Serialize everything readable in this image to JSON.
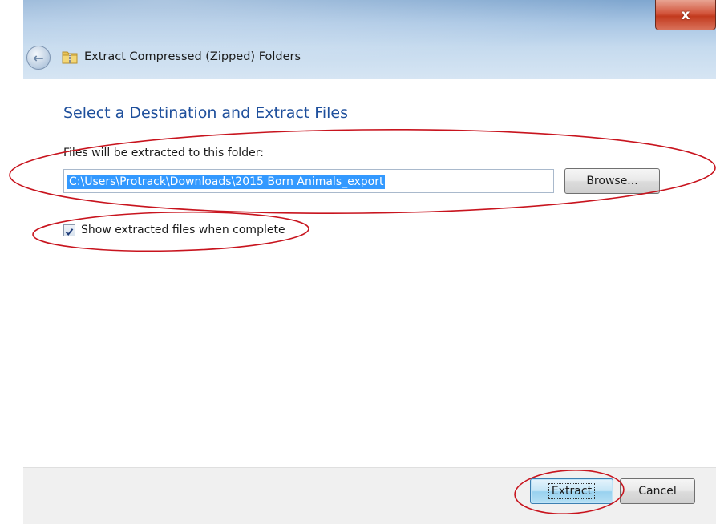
{
  "window": {
    "title": "Extract Compressed (Zipped) Folders",
    "close_label": "x"
  },
  "main": {
    "heading": "Select a Destination and Extract Files",
    "destination_label": "Files will be extracted to this folder:",
    "destination_value": "C:\\Users\\Protrack\\Downloads\\2015 Born Animals_export",
    "browse_label": "Browse...",
    "show_files_label": "Show extracted files when complete",
    "show_files_checked": true
  },
  "footer": {
    "extract_label": "Extract",
    "cancel_label": "Cancel"
  },
  "colors": {
    "heading": "#1e4f9c",
    "annotation": "#c8141e",
    "selection": "#3399ff"
  }
}
